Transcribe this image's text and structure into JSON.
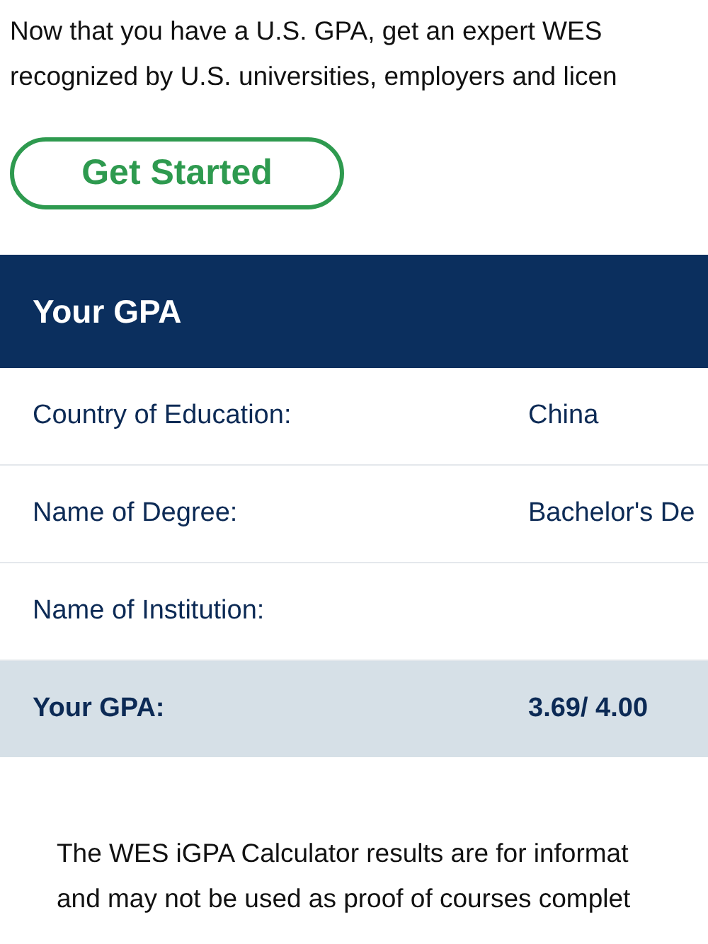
{
  "intro_lines": [
    "Now that you have a U.S. GPA, get an expert WES",
    "recognized by U.S. universities, employers and licen"
  ],
  "button": {
    "label": "Get Started"
  },
  "table": {
    "title": "Your GPA",
    "rows": [
      {
        "label": "Country of Education:",
        "value": "China",
        "kind": "plain"
      },
      {
        "label": "Name of Degree:",
        "value": "Bachelor's De",
        "kind": "plain"
      },
      {
        "label": "Name of Institution:",
        "kind": "plain"
      },
      {
        "label": "Your GPA:",
        "value": "3.69/ 4.00",
        "kind": "total"
      }
    ]
  },
  "disclaimer_lines": [
    "The WES iGPA Calculator results are for informat",
    "and may not be used as proof of courses complet"
  ]
}
